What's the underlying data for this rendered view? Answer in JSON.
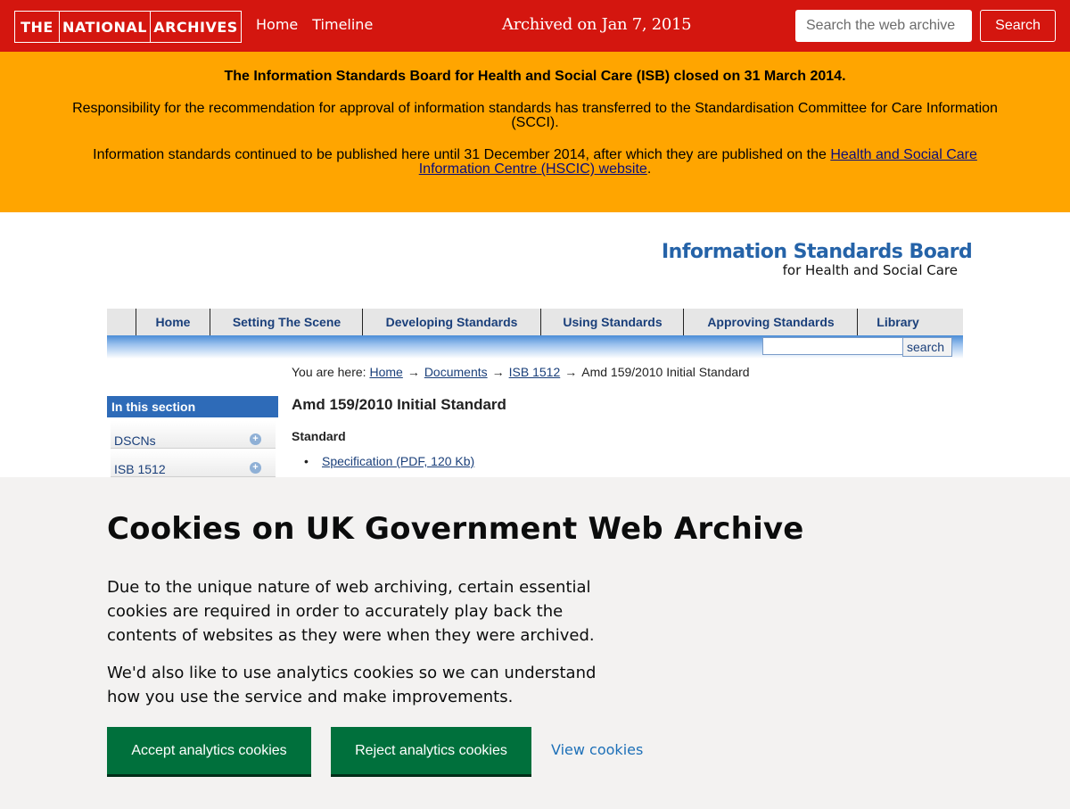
{
  "archive_bar": {
    "logo": [
      "THE",
      "NATIONAL",
      "ARCHIVES"
    ],
    "nav": [
      "Home",
      "Timeline"
    ],
    "archived_on": "Archived on Jan 7, 2015",
    "search_placeholder": "Search the web archive",
    "search_button": "Search",
    "bg_color": "#d4160f"
  },
  "notice": {
    "heading": "The Information Standards Board for Health and Social Care (ISB) closed on 31 March 2014.",
    "line2": "Responsibility for the recommendation for approval of information standards has transferred to the Standardisation Committee for Care Information (SCCI).",
    "line3_prefix": "Information standards continued to be published here until 31 December 2014, after which they are published on the",
    "line3_link": "Health and Social Care Information Centre (HSCIC) website",
    "line3_suffix": ".",
    "bg_color": "#ffa500"
  },
  "site_logo": {
    "line1": "Information Standards Board",
    "line2": "for Health and Social Care"
  },
  "main_nav": {
    "items": [
      "Home",
      "Setting The Scene",
      "Developing Standards",
      "Using Standards",
      "Approving Standards",
      "Library"
    ],
    "search_button": "search"
  },
  "breadcrumb": {
    "prefix": "You are here:",
    "links": [
      "Home",
      "Documents",
      "ISB 1512"
    ],
    "current": "Amd 159/2010 Initial Standard",
    "separator": "→"
  },
  "sidebar": {
    "heading": "In this section",
    "items": [
      "DSCNs",
      "ISB 1512"
    ]
  },
  "content": {
    "title": "Amd 159/2010 Initial Standard",
    "subheading": "Standard",
    "links": [
      "Specification (PDF, 120 Kb)"
    ]
  },
  "cookie_banner": {
    "title": "Cookies on UK Government Web Archive",
    "p1": "Due to the unique nature of web archiving, certain essential cookies are required in order to accurately play back the contents of websites as they were when they were archived.",
    "p2": "We'd also like to use analytics cookies so we can understand how you use the service and make improvements.",
    "accept": "Accept analytics cookies",
    "reject": "Reject analytics cookies",
    "view": "View cookies",
    "button_color": "#00703c"
  }
}
